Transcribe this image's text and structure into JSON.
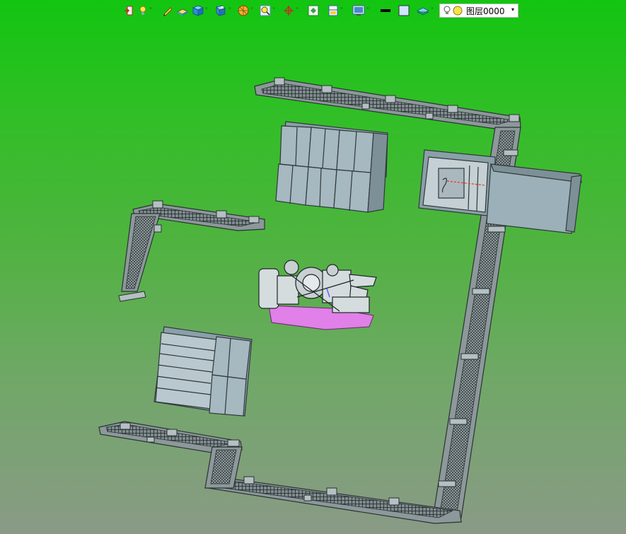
{
  "toolbar": {
    "items": [
      {
        "icon": "exit-icon",
        "has_dropdown": false
      },
      {
        "icon": "light-bulb-icon",
        "has_dropdown": true
      },
      {
        "icon": "pencil-icon",
        "has_dropdown": false
      },
      {
        "icon": "surface-icon",
        "has_dropdown": false
      },
      {
        "icon": "solid-cube-icon",
        "has_dropdown": true
      },
      {
        "icon": "view-cube-icon",
        "has_dropdown": true
      },
      {
        "icon": "render-sphere-icon",
        "has_dropdown": true
      },
      {
        "icon": "zoom-icon",
        "has_dropdown": true
      },
      {
        "icon": "pan-axes-icon",
        "has_dropdown": true
      },
      {
        "icon": "fit-view-icon",
        "has_dropdown": false
      },
      {
        "icon": "section-view-icon",
        "has_dropdown": true
      },
      {
        "icon": "display-mode-icon",
        "has_dropdown": true
      },
      {
        "icon": "line-weight-icon",
        "has_dropdown": false
      },
      {
        "icon": "color-swatch-icon",
        "has_dropdown": false
      },
      {
        "icon": "layer-plane-icon",
        "has_dropdown": true
      }
    ],
    "dropdown_arrow": "˅",
    "layer_selector": {
      "value": "图层0000",
      "caret": "▾"
    }
  },
  "colors": {
    "background_top": "#12c510",
    "background_bottom": "#8a9a86",
    "part_fill": "#9bb0b8",
    "part_stroke": "#333a3c",
    "engine_base": "#e080e8"
  }
}
